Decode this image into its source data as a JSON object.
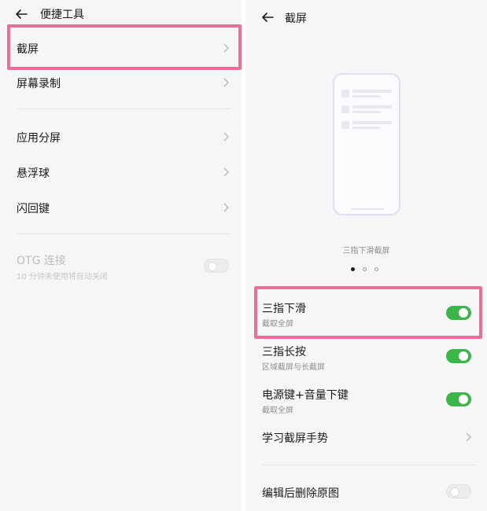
{
  "left": {
    "title": "便捷工具",
    "items": [
      {
        "label": "截屏"
      },
      {
        "label": "屏幕录制"
      },
      {
        "label": "应用分屏"
      },
      {
        "label": "悬浮球"
      },
      {
        "label": "闪回键"
      }
    ],
    "otg": {
      "label": "OTG 连接",
      "sub": "10 分钟未使用将自动关闭",
      "enabled": false
    }
  },
  "right": {
    "title": "截屏",
    "caption": "三指下滑截屏",
    "carousel": {
      "count": 3,
      "active": 0
    },
    "switches": [
      {
        "title": "三指下滑",
        "sub": "截取全屏",
        "on": true
      },
      {
        "title": "三指长按",
        "sub": "区域截屏与长截屏",
        "on": true
      },
      {
        "title": "电源键+音量下键",
        "sub": "截取全屏",
        "on": true
      }
    ],
    "gesture_link": {
      "label": "学习截屏手势"
    },
    "delete_original": {
      "label": "编辑后删除原图",
      "on": false
    }
  },
  "colors": {
    "highlight": "#ec6e98",
    "toggle_on": "#3cb54a",
    "panel_bg": "#f6f6f6"
  },
  "icons": {
    "back": "arrow-left-icon",
    "chevron": "chevron-right-icon"
  }
}
